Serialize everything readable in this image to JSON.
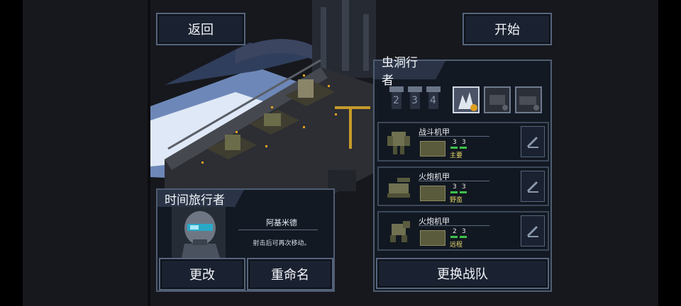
{
  "buttons": {
    "back": "返回",
    "start": "开始",
    "change": "更改",
    "rename": "重命名",
    "swap_squad": "更换战队"
  },
  "squad": {
    "title": "虫洞行者",
    "pilot_slots": [
      "2",
      "3",
      "4"
    ],
    "units": [
      {
        "name": "战斗机甲",
        "stat_a": "3",
        "stat_b": "3",
        "role": "主要"
      },
      {
        "name": "火炮机甲",
        "stat_a": "3",
        "stat_b": "3",
        "role": "野蛮"
      },
      {
        "name": "火炮机甲",
        "stat_a": "2",
        "stat_b": "3",
        "role": "远程"
      }
    ]
  },
  "pilot": {
    "title": "时间旅行者",
    "name": "阿基米德",
    "ability": "射击后可再次移动。"
  },
  "colors": {
    "accent": "#e0a020",
    "panel_border": "#4f5d72",
    "bar_green": "#3ec24a"
  }
}
